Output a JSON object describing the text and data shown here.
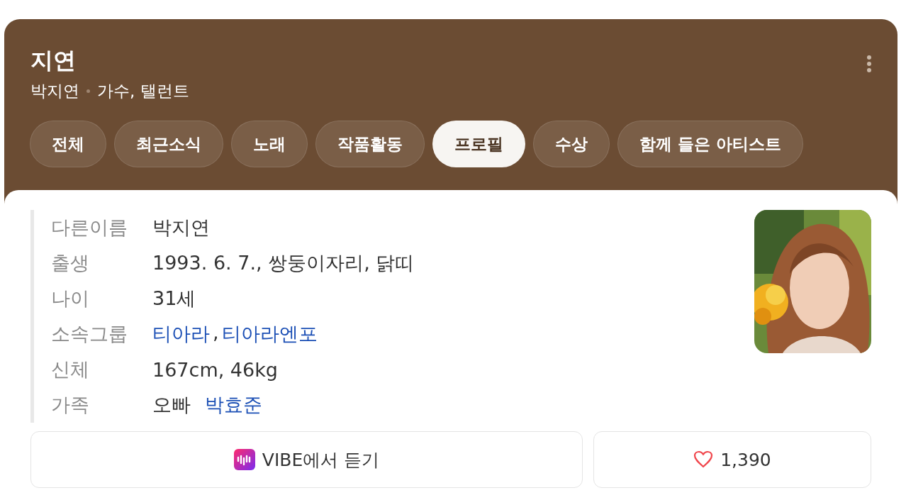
{
  "header": {
    "title": "지연",
    "subtitle": [
      "박지연",
      "가수, 탤런트"
    ]
  },
  "tabs": [
    {
      "label": "전체",
      "selected": false
    },
    {
      "label": "최근소식",
      "selected": false
    },
    {
      "label": "노래",
      "selected": false
    },
    {
      "label": "작품활동",
      "selected": false
    },
    {
      "label": "프로필",
      "selected": true
    },
    {
      "label": "수상",
      "selected": false
    },
    {
      "label": "함께 들은 아티스트",
      "selected": false
    }
  ],
  "profile": [
    {
      "label": "다른이름",
      "value": [
        {
          "text": "박지연",
          "link": false
        }
      ]
    },
    {
      "label": "출생",
      "value": [
        {
          "text": "1993. 6. 7., 쌍둥이자리, 닭띠",
          "link": false
        }
      ]
    },
    {
      "label": "나이",
      "value": [
        {
          "text": "31세",
          "link": false
        }
      ]
    },
    {
      "label": "소속그룹",
      "value": [
        {
          "text": "티아라",
          "link": true
        },
        {
          "text": ",",
          "link": false
        },
        {
          "text": "티아라엔포",
          "link": true
        }
      ]
    },
    {
      "label": "신체",
      "value": [
        {
          "text": "167cm, 46kg",
          "link": false
        }
      ]
    },
    {
      "label": "가족",
      "value": [
        {
          "text": "오빠",
          "link": false
        },
        {
          "text": "박효준",
          "link": true
        }
      ]
    }
  ],
  "actions": {
    "listen": "VIBE에서 듣기",
    "likes": "1,390"
  }
}
